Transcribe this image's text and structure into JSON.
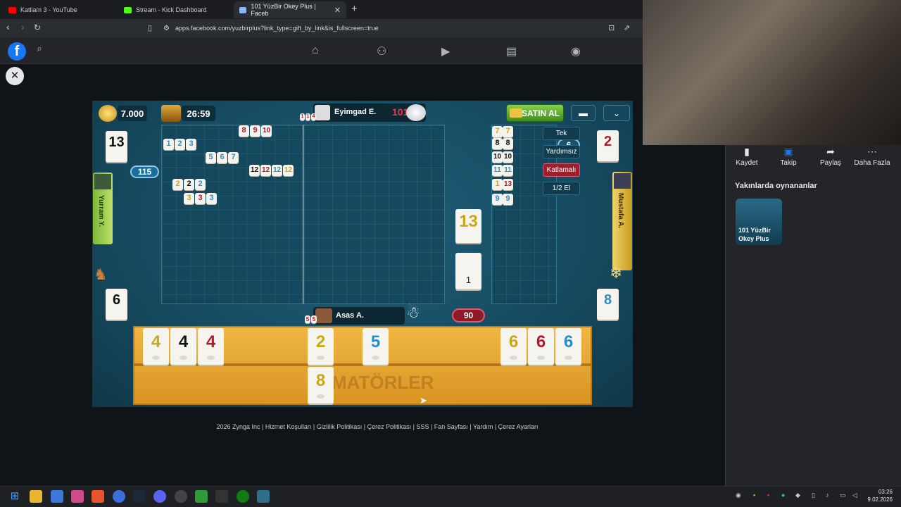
{
  "tabs": [
    {
      "title": "Katliam 3 - YouTube",
      "favicon_color": "#ff0000"
    },
    {
      "title": "Stream - Kick Dashboard",
      "favicon_color": "#53fc18"
    },
    {
      "title": "101 YüzBir Okey Plus | Faceb",
      "favicon_color": "#8ab4f8"
    }
  ],
  "address_bar": {
    "url": "apps.facebook.com/yuzbirplus?link_type=gift_by_link&is_fullscreen=true"
  },
  "icons": {
    "back": "arrow-left-icon",
    "forward": "arrow-right-icon",
    "reload": "reload-icon",
    "bookmark": "bookmark-icon",
    "search": "search-icon",
    "home": "home-icon",
    "friends": "friends-icon",
    "video": "video-icon",
    "marketplace": "marketplace-icon",
    "profile": "profile-icon",
    "close": "close-icon"
  },
  "game": {
    "coins": "7.000",
    "timer": "26:59",
    "buy_button": "SATIN AL",
    "top_player": {
      "name": "Eyimgad E.",
      "score": "101"
    },
    "bottom_player": {
      "name": "Asas A.",
      "score": "90"
    },
    "left_player": {
      "name": "Yurram Y."
    },
    "right_player": {
      "name": "Mustafa A."
    },
    "left_score_badge": "115",
    "right_score_badge": "6",
    "left_top_tile": "13",
    "left_bottom_tile": "6",
    "right_top_tile": "2",
    "right_bottom_tile": "8",
    "rules": [
      "Tek",
      "Yardımsız",
      "Katlamalı",
      "1/2 El"
    ],
    "indicator_tile": "13",
    "deck_count": "1",
    "rack_watermark": "MATÖRLER",
    "board_left": [
      {
        "tiles": [
          "8",
          "9",
          "10"
        ],
        "colors": [
          "r",
          "r",
          "r"
        ]
      },
      {
        "tiles": [
          "1",
          "2",
          "3"
        ],
        "colors": [
          "b",
          "b",
          "b"
        ]
      },
      {
        "tiles": [
          "5",
          "6",
          "7"
        ],
        "colors": [
          "b",
          "b",
          "b"
        ]
      },
      {
        "tiles": [
          "12",
          "12",
          "12",
          "12"
        ],
        "colors": [
          "k",
          "r",
          "b",
          "y"
        ]
      },
      {
        "tiles": [
          "2",
          "2",
          "2"
        ],
        "colors": [
          "y",
          "k",
          "b"
        ]
      },
      {
        "tiles": [
          "3",
          "3",
          "3"
        ],
        "colors": [
          "y",
          "r",
          "b"
        ]
      }
    ],
    "board_right": [
      {
        "tiles": [
          "7",
          "7"
        ],
        "colors": [
          "y",
          "y"
        ]
      },
      {
        "tiles": [
          "8",
          "8"
        ],
        "colors": [
          "k",
          "k"
        ]
      },
      {
        "tiles": [
          "10",
          "10"
        ],
        "colors": [
          "k",
          "k"
        ]
      },
      {
        "tiles": [
          "11",
          "11"
        ],
        "colors": [
          "b",
          "b"
        ]
      },
      {
        "tiles": [
          "1",
          "13"
        ],
        "colors": [
          "y",
          "r"
        ]
      },
      {
        "tiles": [
          "9",
          "9"
        ],
        "colors": [
          "b",
          "b"
        ]
      }
    ],
    "rack_top": [
      {
        "value": "4",
        "color": "y"
      },
      {
        "value": "4",
        "color": "k"
      },
      {
        "value": "4",
        "color": "r"
      },
      {
        "value": "2",
        "color": "y"
      },
      {
        "value": "5",
        "color": "b"
      },
      {
        "value": "6",
        "color": "y"
      },
      {
        "value": "6",
        "color": "r"
      },
      {
        "value": "6",
        "color": "b"
      }
    ],
    "rack_bottom": [
      {
        "value": "8",
        "color": "y"
      }
    ],
    "chip_top": [
      "1",
      "1",
      "4"
    ],
    "chip_bottom": [
      "5",
      "5"
    ]
  },
  "side_actions": [
    "Kaydet",
    "Takip",
    "Paylaş",
    "Daha Fazla"
  ],
  "recent_title": "Yakınlarda oynananlar",
  "recent_game": "101 YüzBir Okey Plus",
  "footer": "2026 Zynga Inc | Hizmet Koşulları | Gizlilik Politikası | Çerez Politikası | SSS | Fan Sayfası | Yardım | Çerez Ayarları",
  "clock": {
    "time": "03:26",
    "date": "9.02.2026"
  }
}
